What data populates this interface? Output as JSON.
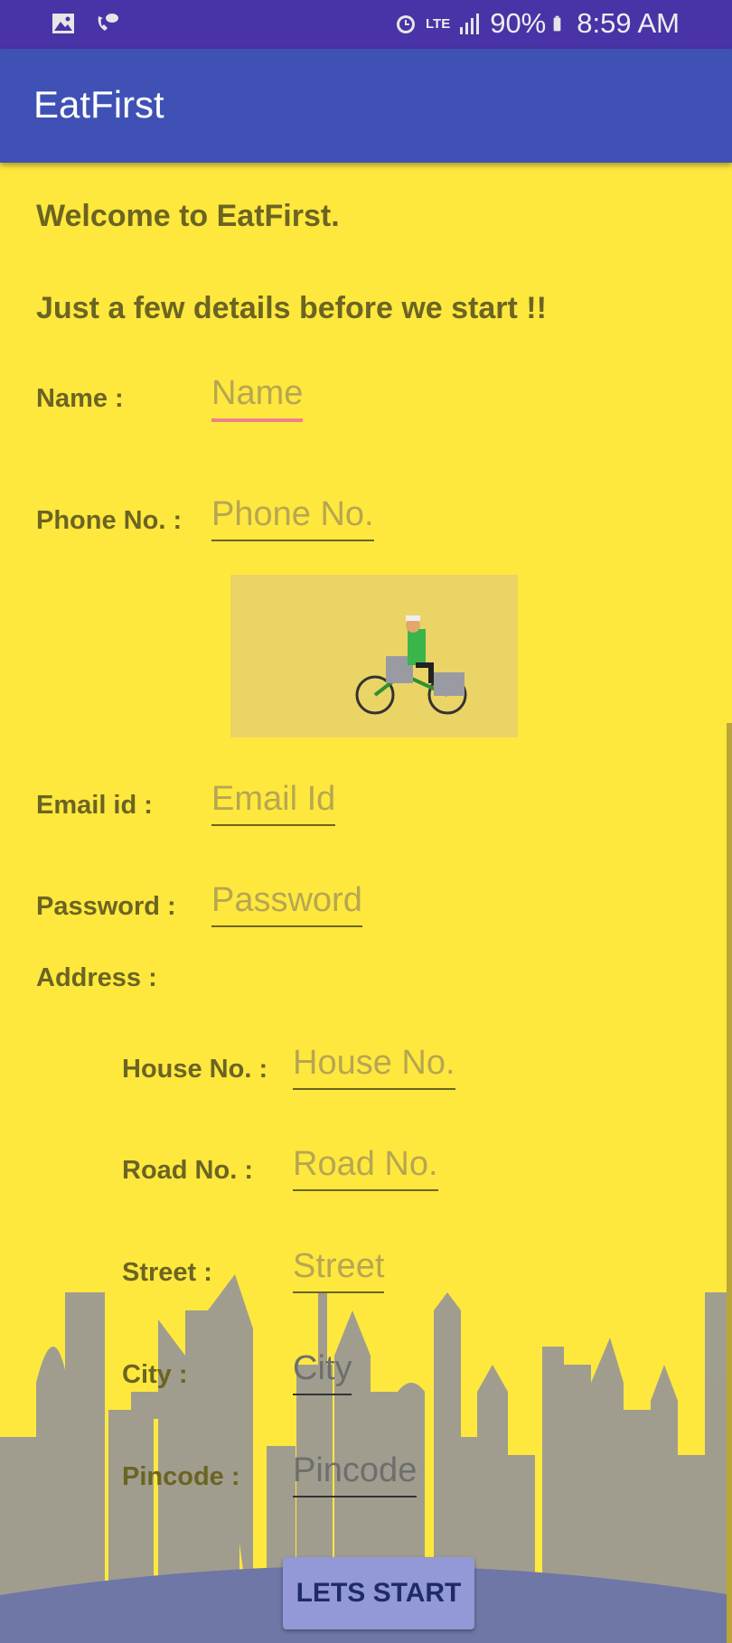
{
  "status_bar": {
    "left_icons": [
      "image-icon",
      "missed-call-icon"
    ],
    "alarm_icon": "alarm-icon",
    "network": "LTE",
    "signal_icon": "signal-icon",
    "battery_percent": "90%",
    "battery_icon": "battery-icon",
    "time": "8:59 AM"
  },
  "app_bar": {
    "title": "EatFirst"
  },
  "welcome": "Welcome to EatFirst.",
  "subtitle": "Just a few details before we start !!",
  "fields": {
    "name": {
      "label": "Name :",
      "placeholder": "Name"
    },
    "phone": {
      "label": "Phone No. :",
      "placeholder": "Phone No."
    },
    "email": {
      "label": "Email id :",
      "placeholder": "Email Id"
    },
    "password": {
      "label": "Password :",
      "placeholder": "Password"
    }
  },
  "address": {
    "label": "Address :",
    "house": {
      "label": "House No. :",
      "placeholder": "House No."
    },
    "road": {
      "label": "Road No. :",
      "placeholder": "Road No."
    },
    "street": {
      "label": "Street :",
      "placeholder": "Street"
    },
    "city": {
      "label": "City :",
      "placeholder": "City"
    },
    "pincode": {
      "label": "Pincode :",
      "placeholder": "Pincode"
    }
  },
  "start_button": "LETS START",
  "colors": {
    "status_bar": "#4a33a6",
    "app_bar": "#3f51b5",
    "background": "#ffe83e",
    "text": "#6b6422",
    "focus_underline": "#f0808b",
    "button": "#9299d6"
  }
}
